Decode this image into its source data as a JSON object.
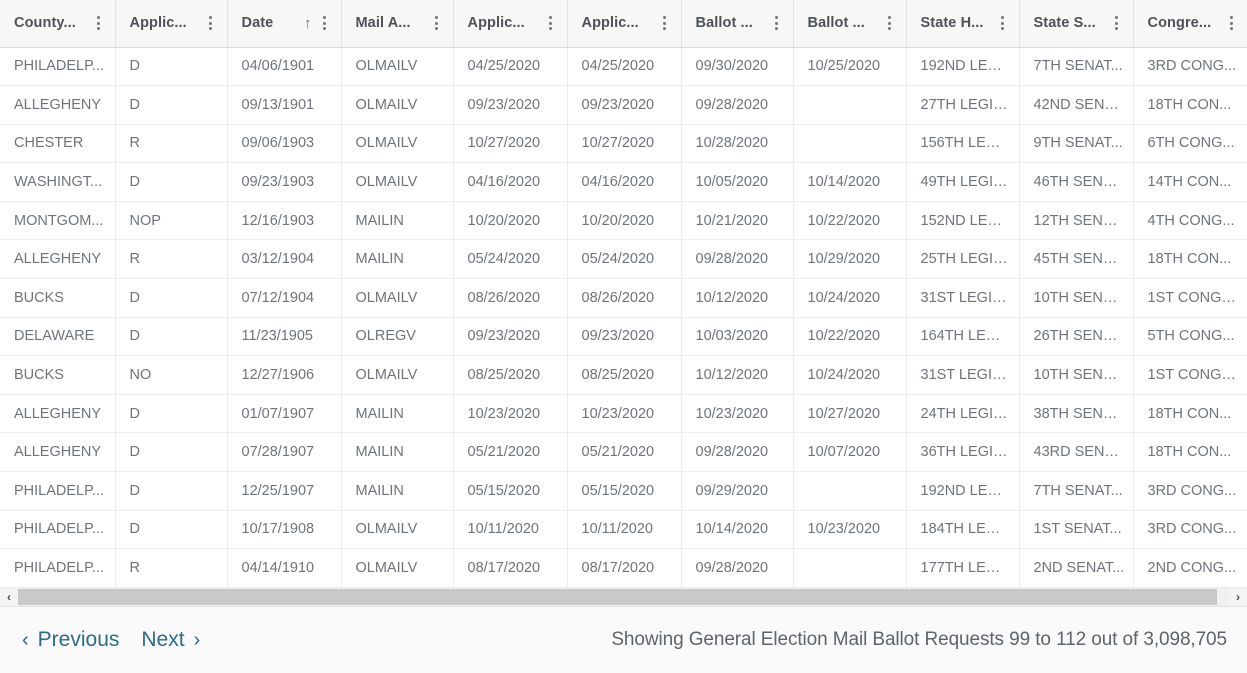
{
  "table": {
    "columns": [
      {
        "label": "County...",
        "name": "county",
        "sorted": false,
        "sort_icon": ""
      },
      {
        "label": "Applic...",
        "name": "applicant-party",
        "sorted": false,
        "sort_icon": ""
      },
      {
        "label": "Date",
        "name": "date",
        "sorted": true,
        "sort_icon": "↑"
      },
      {
        "label": "Mail A...",
        "name": "mail-application-type",
        "sorted": false,
        "sort_icon": ""
      },
      {
        "label": "Applic...",
        "name": "application-approved-date",
        "sorted": false,
        "sort_icon": ""
      },
      {
        "label": "Applic...",
        "name": "application-return-date",
        "sorted": false,
        "sort_icon": ""
      },
      {
        "label": "Ballot ...",
        "name": "ballot-mailed-date",
        "sorted": false,
        "sort_icon": ""
      },
      {
        "label": "Ballot ...",
        "name": "ballot-returned-date",
        "sorted": false,
        "sort_icon": ""
      },
      {
        "label": "State H...",
        "name": "state-house-district",
        "sorted": false,
        "sort_icon": ""
      },
      {
        "label": "State S...",
        "name": "state-senate-district",
        "sorted": false,
        "sort_icon": ""
      },
      {
        "label": "Congre...",
        "name": "congressional-district",
        "sorted": false,
        "sort_icon": ""
      }
    ],
    "rows": [
      [
        "PHILADELP...",
        "D",
        "04/06/1901",
        "OLMAILV",
        "04/25/2020",
        "04/25/2020",
        "09/30/2020",
        "10/25/2020",
        "192ND LEG...",
        "7TH SENAT...",
        "3RD CONG..."
      ],
      [
        "ALLEGHENY",
        "D",
        "09/13/1901",
        "OLMAILV",
        "09/23/2020",
        "09/23/2020",
        "09/28/2020",
        "",
        "27TH LEGIS...",
        "42ND SENA...",
        "18TH CON..."
      ],
      [
        "CHESTER",
        "R",
        "09/06/1903",
        "OLMAILV",
        "10/27/2020",
        "10/27/2020",
        "10/28/2020",
        "",
        "156TH LEGI...",
        "9TH SENAT...",
        "6TH CONG..."
      ],
      [
        "WASHINGT...",
        "D",
        "09/23/1903",
        "OLMAILV",
        "04/16/2020",
        "04/16/2020",
        "10/05/2020",
        "10/14/2020",
        "49TH LEGIS...",
        "46TH SENA...",
        "14TH CON..."
      ],
      [
        "MONTGOM...",
        "NOP",
        "12/16/1903",
        "MAILIN",
        "10/20/2020",
        "10/20/2020",
        "10/21/2020",
        "10/22/2020",
        "152ND LEG...",
        "12TH SENA...",
        "4TH CONG..."
      ],
      [
        "ALLEGHENY",
        "R",
        "03/12/1904",
        "MAILIN",
        "05/24/2020",
        "05/24/2020",
        "09/28/2020",
        "10/29/2020",
        "25TH LEGIS...",
        "45TH SENA...",
        "18TH CON..."
      ],
      [
        "BUCKS",
        "D",
        "07/12/1904",
        "OLMAILV",
        "08/26/2020",
        "08/26/2020",
        "10/12/2020",
        "10/24/2020",
        "31ST LEGIS...",
        "10TH SENA...",
        "1ST CONGR..."
      ],
      [
        "DELAWARE",
        "D",
        "11/23/1905",
        "OLREGV",
        "09/23/2020",
        "09/23/2020",
        "10/03/2020",
        "10/22/2020",
        "164TH LEGI...",
        "26TH SENA...",
        "5TH CONG..."
      ],
      [
        "BUCKS",
        "NO",
        "12/27/1906",
        "OLMAILV",
        "08/25/2020",
        "08/25/2020",
        "10/12/2020",
        "10/24/2020",
        "31ST LEGIS...",
        "10TH SENA...",
        "1ST CONGR..."
      ],
      [
        "ALLEGHENY",
        "D",
        "01/07/1907",
        "MAILIN",
        "10/23/2020",
        "10/23/2020",
        "10/23/2020",
        "10/27/2020",
        "24TH LEGIS...",
        "38TH SENA...",
        "18TH CON..."
      ],
      [
        "ALLEGHENY",
        "D",
        "07/28/1907",
        "MAILIN",
        "05/21/2020",
        "05/21/2020",
        "09/28/2020",
        "10/07/2020",
        "36TH LEGIS...",
        "43RD SENA...",
        "18TH CON..."
      ],
      [
        "PHILADELP...",
        "D",
        "12/25/1907",
        "MAILIN",
        "05/15/2020",
        "05/15/2020",
        "09/29/2020",
        "",
        "192ND LEG...",
        "7TH SENAT...",
        "3RD CONG..."
      ],
      [
        "PHILADELP...",
        "D",
        "10/17/1908",
        "OLMAILV",
        "10/11/2020",
        "10/11/2020",
        "10/14/2020",
        "10/23/2020",
        "184TH LEGI...",
        "1ST SENAT...",
        "3RD CONG..."
      ],
      [
        "PHILADELP...",
        "R",
        "04/14/1910",
        "OLMAILV",
        "08/17/2020",
        "08/17/2020",
        "09/28/2020",
        "",
        "177TH LEGI...",
        "2ND SENAT...",
        "2ND CONG..."
      ]
    ]
  },
  "scrollbar": {
    "left_arrow": "‹",
    "right_arrow": "›"
  },
  "footer": {
    "previous_label": "Previous",
    "previous_chevron": "‹",
    "next_label": "Next",
    "next_chevron": "›",
    "status": "Showing General Election Mail Ballot Requests 99 to 112 out of 3,098,705"
  },
  "colors": {
    "header_bg": "#f7f7f7",
    "header_text": "#4c5258",
    "cell_text": "#6e7479",
    "link": "#2b6b8f",
    "border": "#ededed",
    "scrollbar_thumb": "#c9c9c9"
  }
}
